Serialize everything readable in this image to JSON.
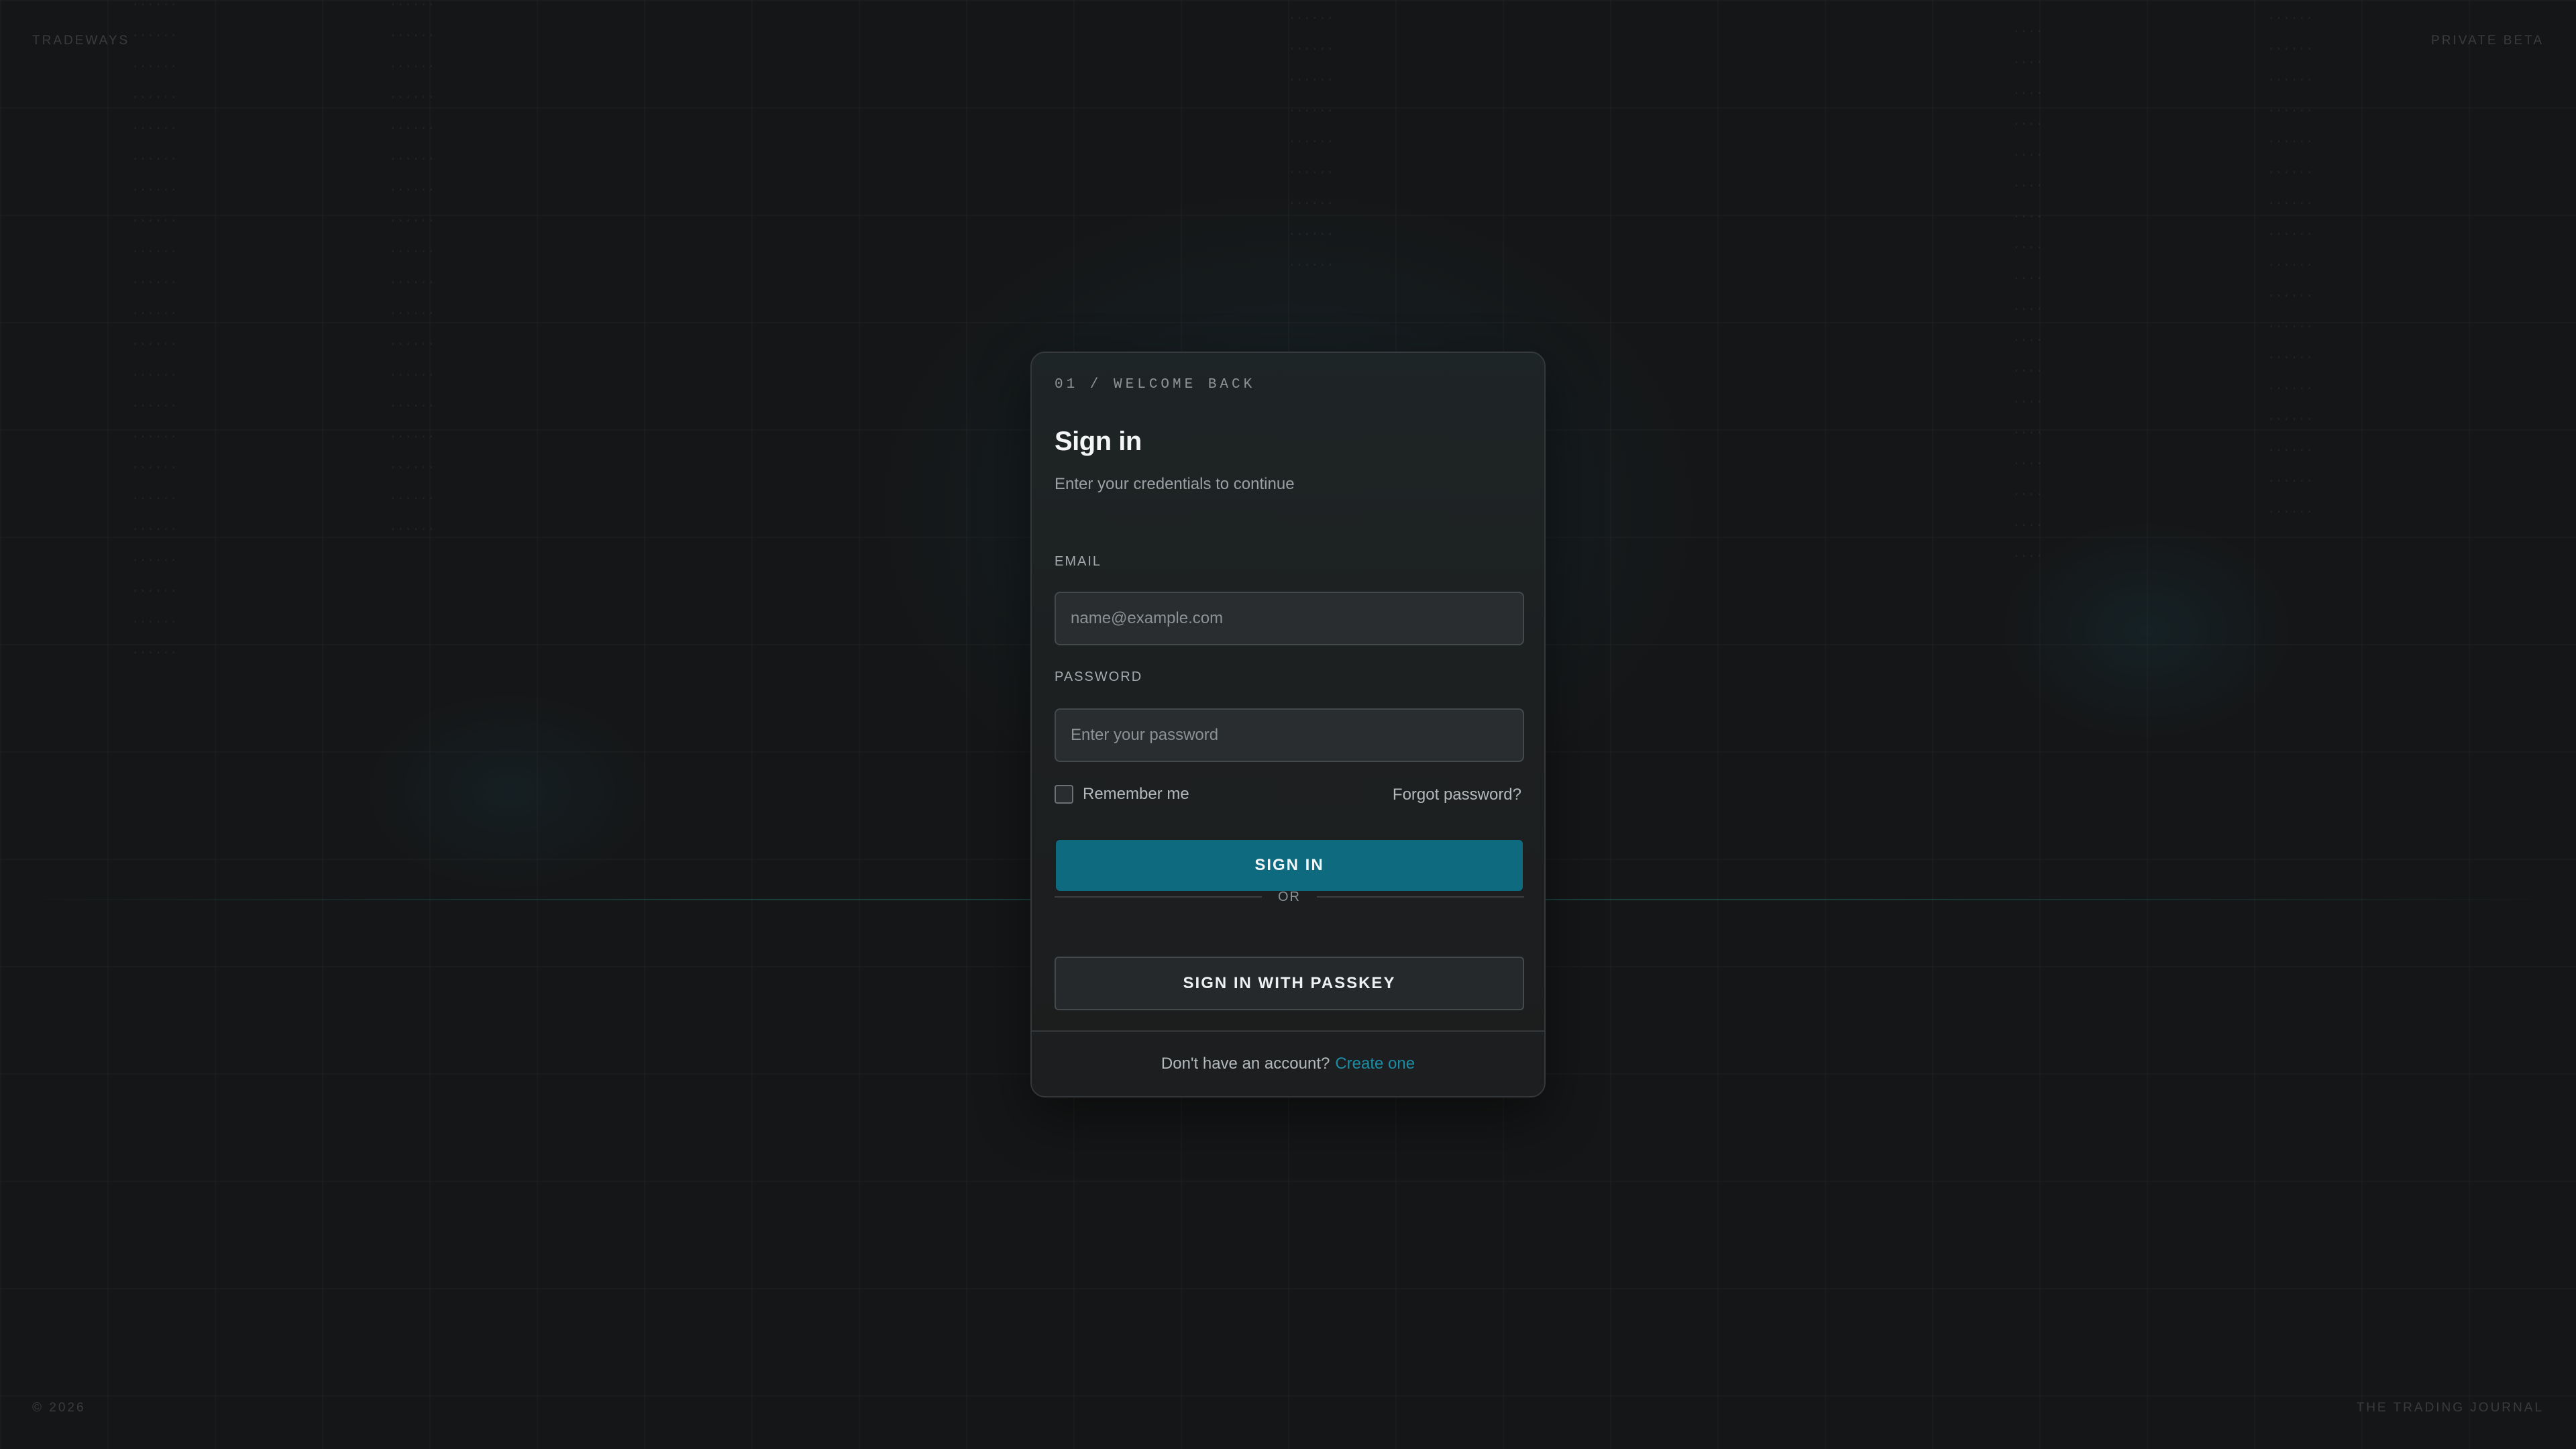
{
  "brand": "TRADEWAYS",
  "badge": "PRIVATE BETA",
  "copyright": "© 2026",
  "tagline": "THE TRADING JOURNAL",
  "signin": {
    "eyebrow": "01 / WELCOME BACK",
    "title": "Sign in",
    "subtitle": "Enter your credentials to continue",
    "email_label": "EMAIL",
    "email_placeholder": "name@example.com",
    "email_value": "",
    "password_label": "PASSWORD",
    "password_placeholder": "Enter your password",
    "password_value": "",
    "remember_label": "Remember me",
    "remember_checked": false,
    "forgot_label": "Forgot password?",
    "submit_label": "SIGN IN",
    "divider_label": "OR",
    "passkey_label": "SIGN IN WITH PASSKEY",
    "footer_text": "Don't have an account?",
    "footer_link": "Create one"
  },
  "colors": {
    "background": "#151617",
    "card": "#1d2021",
    "accent": "#0e6a7f",
    "link": "#1c8da6"
  }
}
